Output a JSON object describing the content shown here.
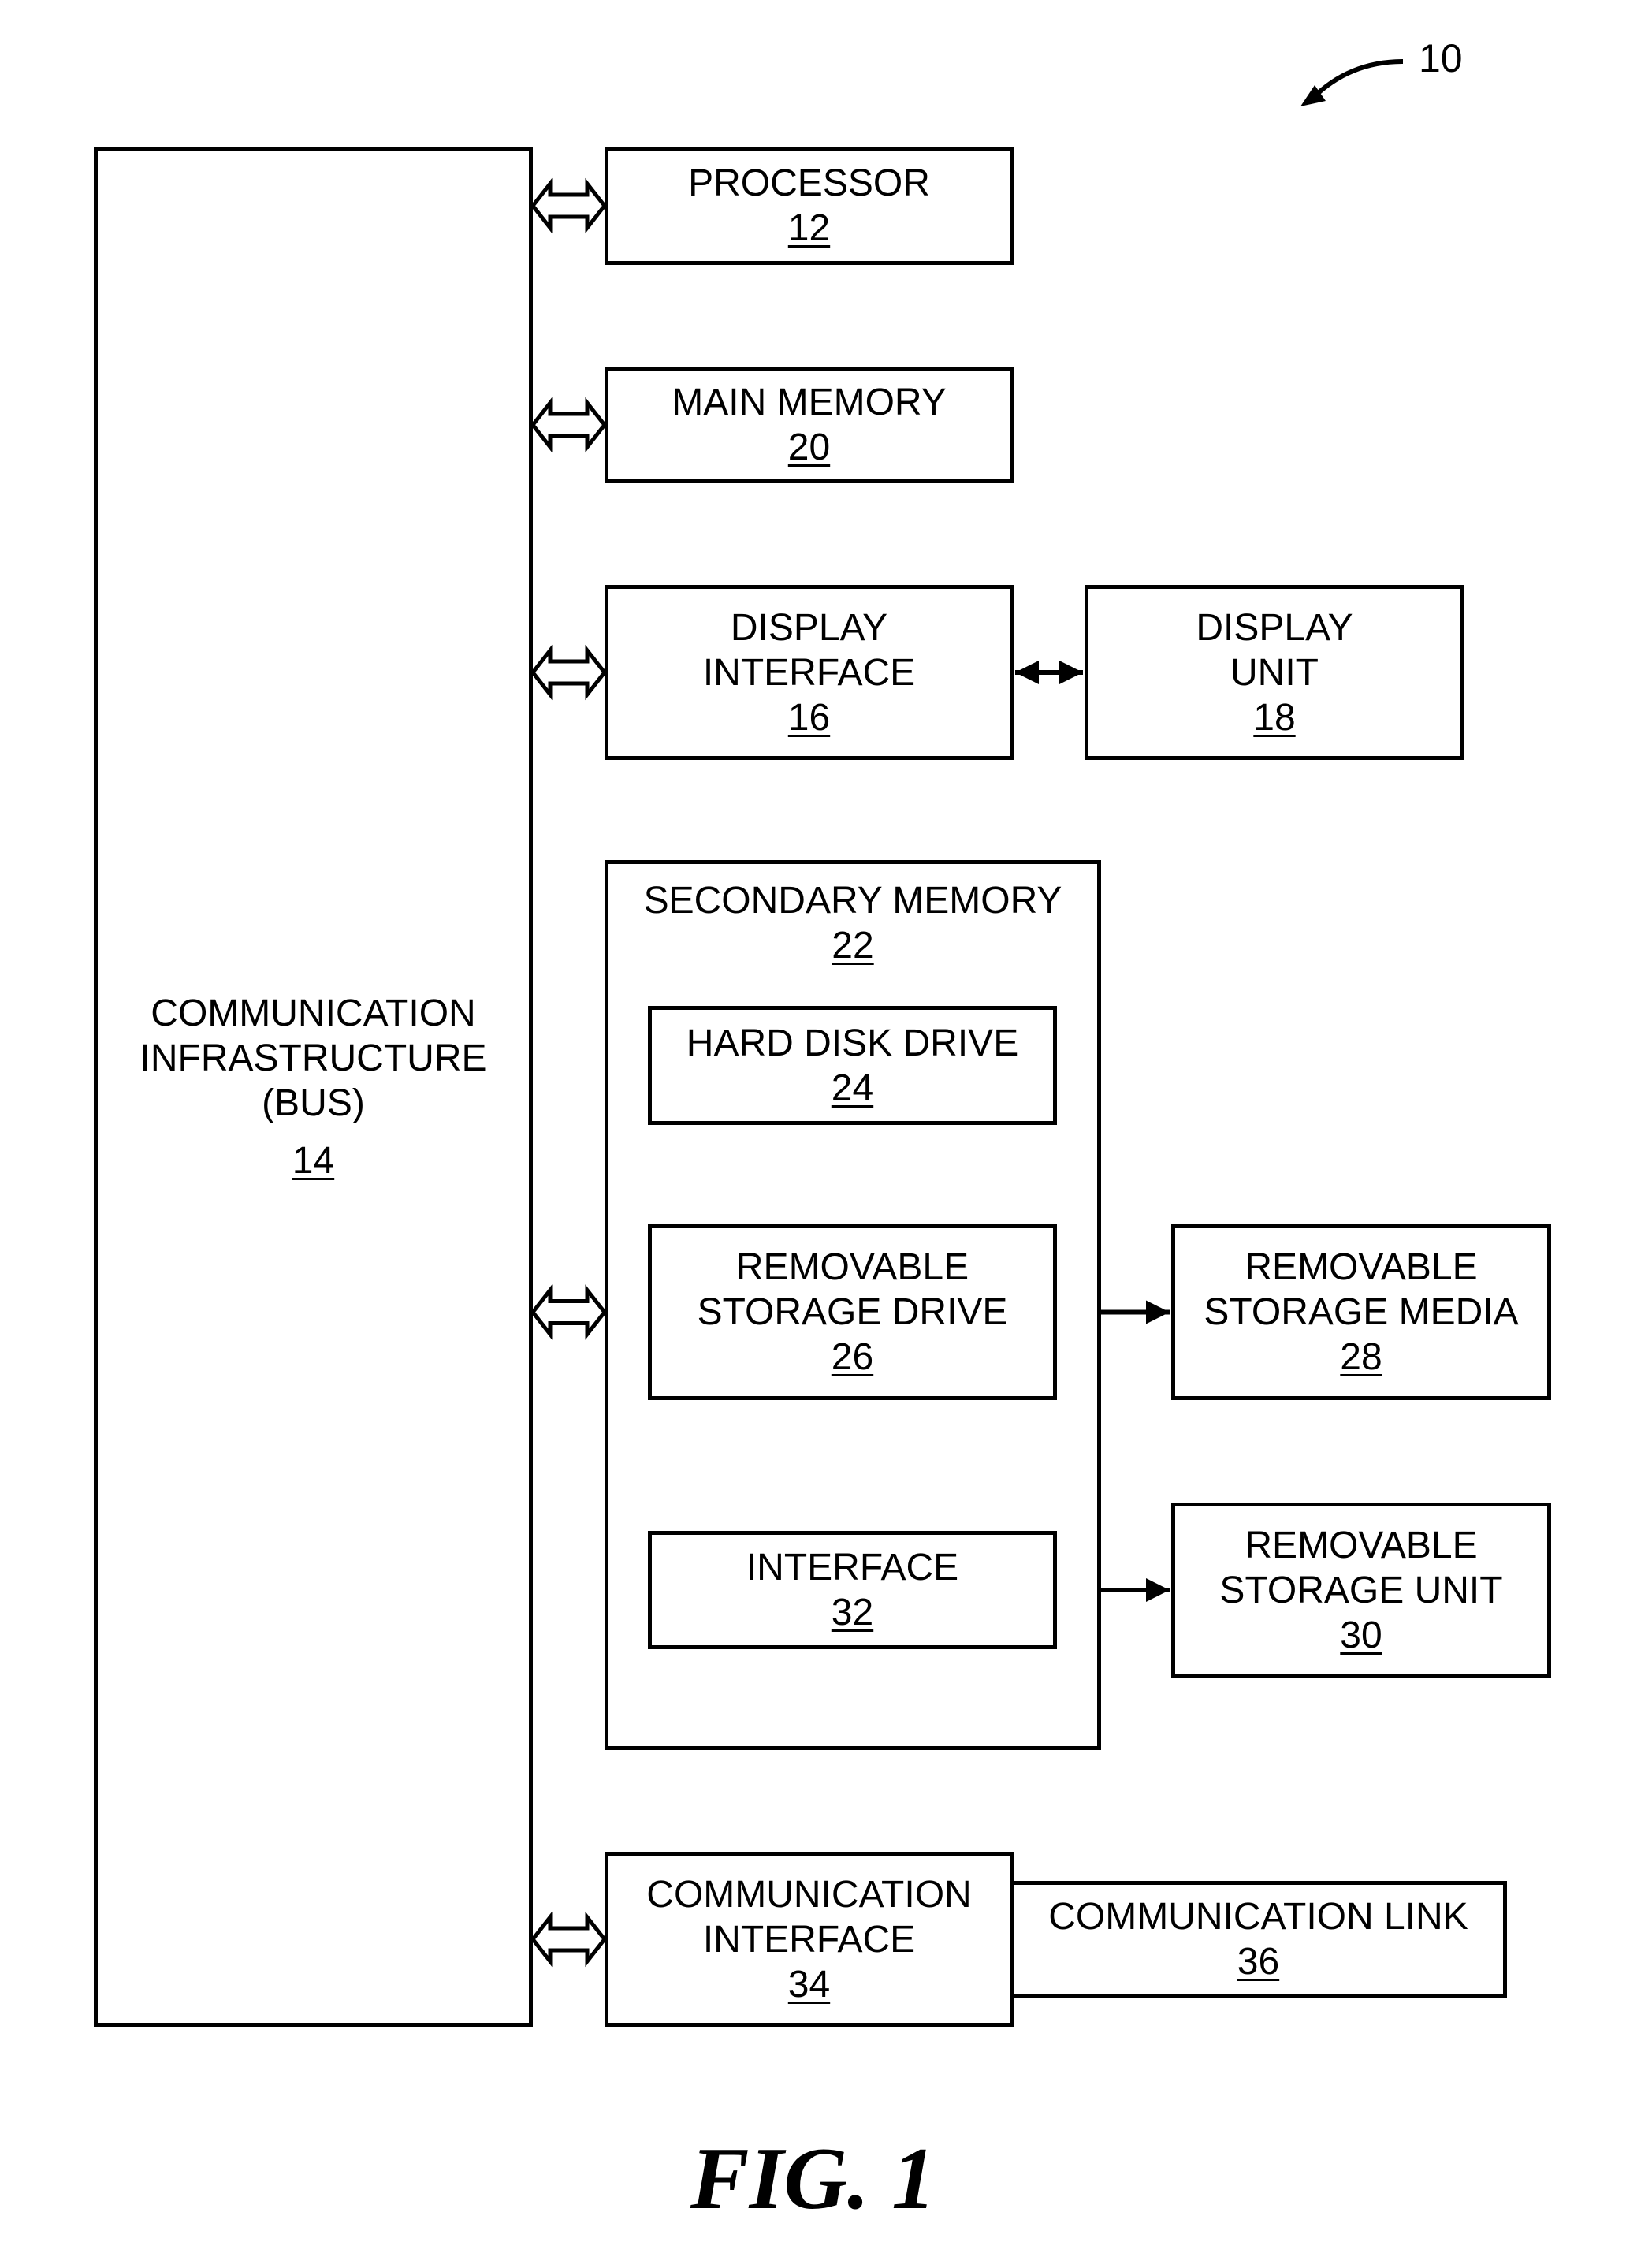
{
  "figure": {
    "label": "FIG. 1",
    "reference_numeral": "10"
  },
  "blocks": {
    "bus": {
      "lines": [
        "COMMUNICATION",
        "INFRASTRUCTURE",
        "(BUS)"
      ],
      "ref": "14"
    },
    "processor": {
      "lines": [
        "PROCESSOR"
      ],
      "ref": "12"
    },
    "main_memory": {
      "lines": [
        "MAIN MEMORY"
      ],
      "ref": "20"
    },
    "display_interface": {
      "lines": [
        "DISPLAY",
        "INTERFACE"
      ],
      "ref": "16"
    },
    "display_unit": {
      "lines": [
        "DISPLAY",
        "UNIT"
      ],
      "ref": "18"
    },
    "secondary_memory": {
      "lines": [
        "SECONDARY MEMORY"
      ],
      "ref": "22"
    },
    "hard_disk_drive": {
      "lines": [
        "HARD DISK DRIVE"
      ],
      "ref": "24"
    },
    "removable_storage_drive": {
      "lines": [
        "REMOVABLE",
        "STORAGE DRIVE"
      ],
      "ref": "26"
    },
    "removable_storage_media": {
      "lines": [
        "REMOVABLE",
        "STORAGE MEDIA"
      ],
      "ref": "28"
    },
    "interface": {
      "lines": [
        "INTERFACE"
      ],
      "ref": "32"
    },
    "removable_storage_unit": {
      "lines": [
        "REMOVABLE",
        "STORAGE UNIT"
      ],
      "ref": "30"
    },
    "communication_interface": {
      "lines": [
        "COMMUNICATION",
        "INTERFACE"
      ],
      "ref": "34"
    },
    "communication_link": {
      "lines": [
        "COMMUNICATION LINK"
      ],
      "ref": "36"
    }
  },
  "connections": [
    {
      "from": "bus",
      "to": "processor",
      "style": "bus-double-arrow"
    },
    {
      "from": "bus",
      "to": "main_memory",
      "style": "bus-double-arrow"
    },
    {
      "from": "bus",
      "to": "display_interface",
      "style": "bus-double-arrow"
    },
    {
      "from": "bus",
      "to": "secondary_memory",
      "style": "bus-double-arrow"
    },
    {
      "from": "bus",
      "to": "communication_interface",
      "style": "bus-double-arrow"
    },
    {
      "from": "display_interface",
      "to": "display_unit",
      "style": "bidirectional-arrow"
    },
    {
      "from": "removable_storage_drive",
      "to": "removable_storage_media",
      "style": "bidirectional-arrow"
    },
    {
      "from": "interface",
      "to": "removable_storage_unit",
      "style": "bidirectional-arrow"
    },
    {
      "from": "communication_interface",
      "to": "communication_link",
      "style": "adjacent"
    }
  ]
}
